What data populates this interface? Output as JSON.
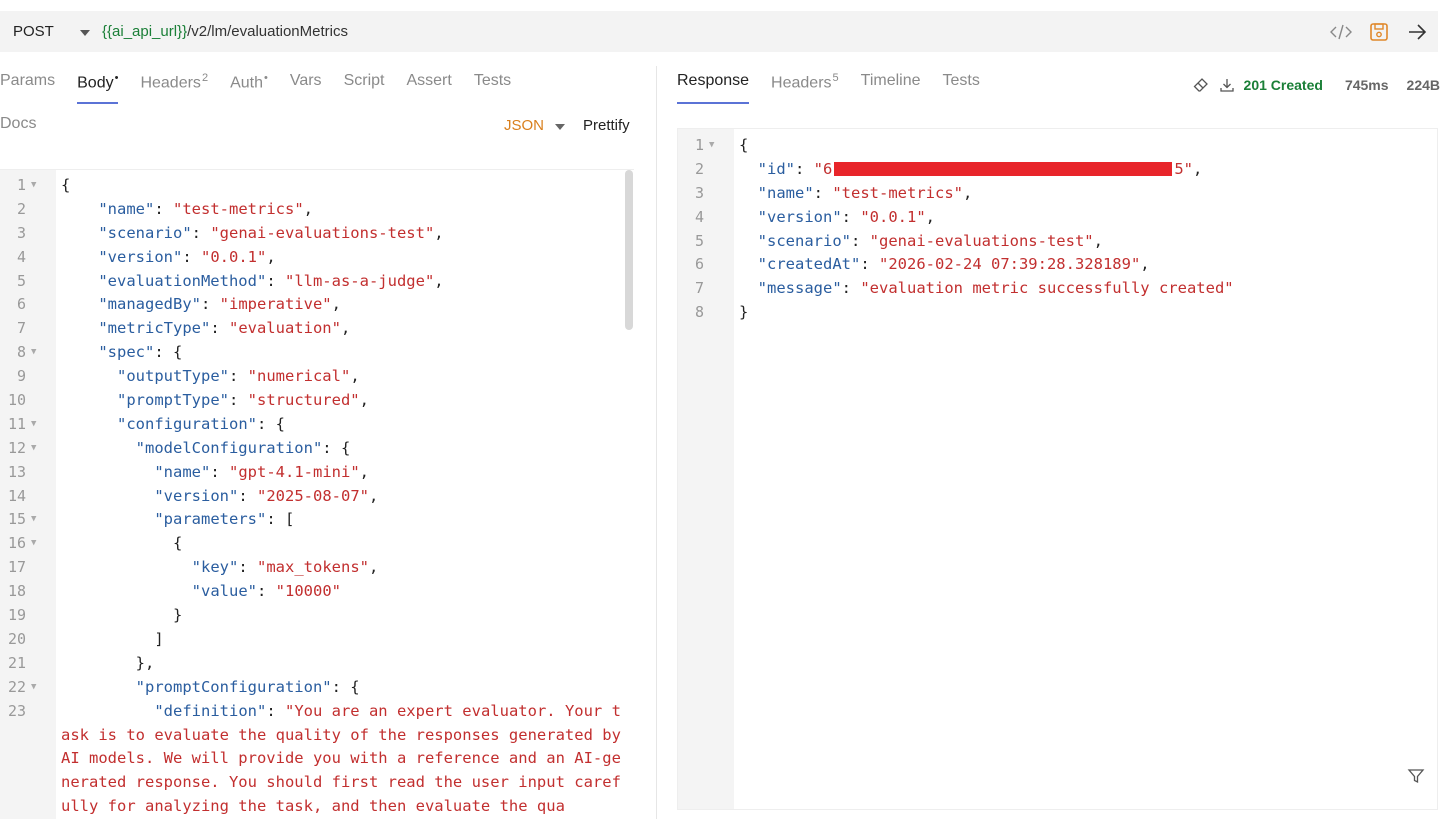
{
  "request": {
    "method": "POST",
    "url_var": "{{ai_api_url}}",
    "url_path": "/v2/lm/evaluationMetrics"
  },
  "left_tabs": [
    {
      "label": "Params",
      "active": false,
      "badge": ""
    },
    {
      "label": "Body",
      "active": true,
      "badge": "•"
    },
    {
      "label": "Headers",
      "active": false,
      "badge": "2"
    },
    {
      "label": "Auth",
      "active": false,
      "badge": "•"
    },
    {
      "label": "Vars",
      "active": false,
      "badge": ""
    },
    {
      "label": "Script",
      "active": false,
      "badge": ""
    },
    {
      "label": "Assert",
      "active": false,
      "badge": ""
    },
    {
      "label": "Tests",
      "active": false,
      "badge": ""
    }
  ],
  "docs_label": "Docs",
  "body_mode": "JSON",
  "prettify_label": "Prettify",
  "request_body": {
    "lines": [
      {
        "n": "1",
        "fold": true,
        "t": [
          [
            "p",
            "{"
          ]
        ]
      },
      {
        "n": "2",
        "fold": false,
        "t": [
          [
            "p",
            "    "
          ],
          [
            "k",
            "\"name\""
          ],
          [
            "p",
            ": "
          ],
          [
            "s",
            "\"test-metrics\""
          ],
          [
            "p",
            ","
          ]
        ]
      },
      {
        "n": "3",
        "fold": false,
        "t": [
          [
            "p",
            "    "
          ],
          [
            "k",
            "\"scenario\""
          ],
          [
            "p",
            ": "
          ],
          [
            "s",
            "\"genai-evaluations-test\""
          ],
          [
            "p",
            ","
          ]
        ]
      },
      {
        "n": "4",
        "fold": false,
        "t": [
          [
            "p",
            "    "
          ],
          [
            "k",
            "\"version\""
          ],
          [
            "p",
            ": "
          ],
          [
            "s",
            "\"0.0.1\""
          ],
          [
            "p",
            ","
          ]
        ]
      },
      {
        "n": "5",
        "fold": false,
        "t": [
          [
            "p",
            "    "
          ],
          [
            "k",
            "\"evaluationMethod\""
          ],
          [
            "p",
            ": "
          ],
          [
            "s",
            "\"llm-as-a-judge\""
          ],
          [
            "p",
            ","
          ]
        ]
      },
      {
        "n": "6",
        "fold": false,
        "t": [
          [
            "p",
            "    "
          ],
          [
            "k",
            "\"managedBy\""
          ],
          [
            "p",
            ": "
          ],
          [
            "s",
            "\"imperative\""
          ],
          [
            "p",
            ","
          ]
        ]
      },
      {
        "n": "7",
        "fold": false,
        "t": [
          [
            "p",
            "    "
          ],
          [
            "k",
            "\"metricType\""
          ],
          [
            "p",
            ": "
          ],
          [
            "s",
            "\"evaluation\""
          ],
          [
            "p",
            ","
          ]
        ]
      },
      {
        "n": "8",
        "fold": true,
        "t": [
          [
            "p",
            "    "
          ],
          [
            "k",
            "\"spec\""
          ],
          [
            "p",
            ": {"
          ]
        ]
      },
      {
        "n": "9",
        "fold": false,
        "t": [
          [
            "p",
            "      "
          ],
          [
            "k",
            "\"outputType\""
          ],
          [
            "p",
            ": "
          ],
          [
            "s",
            "\"numerical\""
          ],
          [
            "p",
            ","
          ]
        ]
      },
      {
        "n": "10",
        "fold": false,
        "t": [
          [
            "p",
            "      "
          ],
          [
            "k",
            "\"promptType\""
          ],
          [
            "p",
            ": "
          ],
          [
            "s",
            "\"structured\""
          ],
          [
            "p",
            ","
          ]
        ]
      },
      {
        "n": "11",
        "fold": true,
        "t": [
          [
            "p",
            "      "
          ],
          [
            "k",
            "\"configuration\""
          ],
          [
            "p",
            ": {"
          ]
        ]
      },
      {
        "n": "12",
        "fold": true,
        "t": [
          [
            "p",
            "        "
          ],
          [
            "k",
            "\"modelConfiguration\""
          ],
          [
            "p",
            ": {"
          ]
        ]
      },
      {
        "n": "13",
        "fold": false,
        "t": [
          [
            "p",
            "          "
          ],
          [
            "k",
            "\"name\""
          ],
          [
            "p",
            ": "
          ],
          [
            "s",
            "\"gpt-4.1-mini\""
          ],
          [
            "p",
            ","
          ]
        ]
      },
      {
        "n": "14",
        "fold": false,
        "t": [
          [
            "p",
            "          "
          ],
          [
            "k",
            "\"version\""
          ],
          [
            "p",
            ": "
          ],
          [
            "s",
            "\"2025-08-07\""
          ],
          [
            "p",
            ","
          ]
        ]
      },
      {
        "n": "15",
        "fold": true,
        "t": [
          [
            "p",
            "          "
          ],
          [
            "k",
            "\"parameters\""
          ],
          [
            "p",
            ": ["
          ]
        ]
      },
      {
        "n": "16",
        "fold": true,
        "t": [
          [
            "p",
            "            {"
          ]
        ]
      },
      {
        "n": "17",
        "fold": false,
        "t": [
          [
            "p",
            "              "
          ],
          [
            "k",
            "\"key\""
          ],
          [
            "p",
            ": "
          ],
          [
            "s",
            "\"max_tokens\""
          ],
          [
            "p",
            ","
          ]
        ]
      },
      {
        "n": "18",
        "fold": false,
        "t": [
          [
            "p",
            "              "
          ],
          [
            "k",
            "\"value\""
          ],
          [
            "p",
            ": "
          ],
          [
            "s",
            "\"10000\""
          ]
        ]
      },
      {
        "n": "19",
        "fold": false,
        "t": [
          [
            "p",
            "            }"
          ]
        ]
      },
      {
        "n": "20",
        "fold": false,
        "t": [
          [
            "p",
            "          ]"
          ]
        ]
      },
      {
        "n": "21",
        "fold": false,
        "t": [
          [
            "p",
            "        },"
          ]
        ]
      },
      {
        "n": "22",
        "fold": true,
        "t": [
          [
            "p",
            "        "
          ],
          [
            "k",
            "\"promptConfiguration\""
          ],
          [
            "p",
            ": {"
          ]
        ]
      },
      {
        "n": "23",
        "fold": false,
        "t": [
          [
            "p",
            "          "
          ],
          [
            "k",
            "\"definition\""
          ],
          [
            "p",
            ": "
          ],
          [
            "s",
            "\"You are an expert evaluator. Your task is to evaluate the quality of the responses generated by AI models. We will provide you with a reference and an AI-generated response. You should first read the user input carefully for analyzing the task, and then evaluate the qua"
          ]
        ]
      }
    ]
  },
  "right_tabs": [
    {
      "label": "Response",
      "active": true,
      "badge": ""
    },
    {
      "label": "Headers",
      "active": false,
      "badge": "5"
    },
    {
      "label": "Timeline",
      "active": false,
      "badge": ""
    },
    {
      "label": "Tests",
      "active": false,
      "badge": ""
    }
  ],
  "response_status": {
    "status": "201 Created",
    "time": "745ms",
    "size": "224B",
    "status_color": "#1a7f37"
  },
  "response_body": {
    "id_start": "6",
    "id_end": "5",
    "lines": [
      {
        "n": "1",
        "fold": true,
        "t": [
          [
            "p",
            "{"
          ]
        ]
      },
      {
        "n": "3",
        "fold": false,
        "t": [
          [
            "p",
            "  "
          ],
          [
            "k",
            "\"name\""
          ],
          [
            "p",
            ": "
          ],
          [
            "s",
            "\"test-metrics\""
          ],
          [
            "p",
            ","
          ]
        ]
      },
      {
        "n": "4",
        "fold": false,
        "t": [
          [
            "p",
            "  "
          ],
          [
            "k",
            "\"version\""
          ],
          [
            "p",
            ": "
          ],
          [
            "s",
            "\"0.0.1\""
          ],
          [
            "p",
            ","
          ]
        ]
      },
      {
        "n": "5",
        "fold": false,
        "t": [
          [
            "p",
            "  "
          ],
          [
            "k",
            "\"scenario\""
          ],
          [
            "p",
            ": "
          ],
          [
            "s",
            "\"genai-evaluations-test\""
          ],
          [
            "p",
            ","
          ]
        ]
      },
      {
        "n": "6",
        "fold": false,
        "t": [
          [
            "p",
            "  "
          ],
          [
            "k",
            "\"createdAt\""
          ],
          [
            "p",
            ": "
          ],
          [
            "s",
            "\"2026-02-24 07:39:28.328189\""
          ],
          [
            "p",
            ","
          ]
        ]
      },
      {
        "n": "7",
        "fold": false,
        "t": [
          [
            "p",
            "  "
          ],
          [
            "k",
            "\"message\""
          ],
          [
            "p",
            ": "
          ],
          [
            "s",
            "\"evaluation metric successfully created\""
          ]
        ]
      },
      {
        "n": "8",
        "fold": false,
        "t": [
          [
            "p",
            "}"
          ]
        ]
      }
    ]
  },
  "icons": [
    "code-icon",
    "save-icon",
    "send-arrow-icon",
    "eraser-icon",
    "download-icon",
    "filter-icon"
  ]
}
